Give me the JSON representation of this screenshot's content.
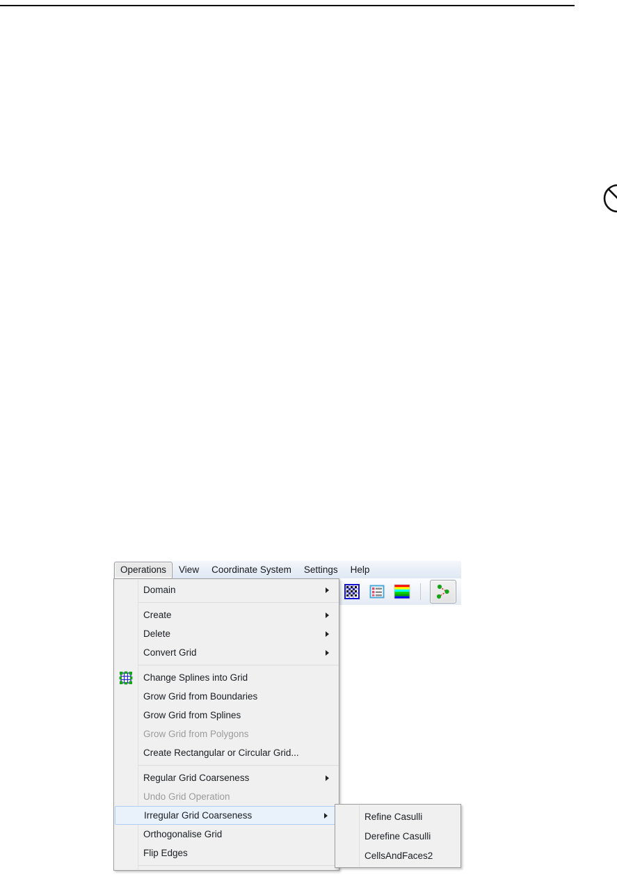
{
  "window": {
    "menubar": [
      {
        "label": "Operations",
        "active": true
      },
      {
        "label": "View",
        "active": false
      },
      {
        "label": "Coordinate System",
        "active": false
      },
      {
        "label": "Settings",
        "active": false
      },
      {
        "label": "Help",
        "active": false
      }
    ],
    "toolbar": {
      "buttons": [
        {
          "icon": "checkerboard-grid-icon",
          "label": "Show Grid",
          "pressed": false
        },
        {
          "icon": "list-properties-icon",
          "label": "Properties List",
          "pressed": false
        },
        {
          "icon": "rainbow-colormap-icon",
          "label": "Colour Map",
          "pressed": false
        },
        {
          "icon": "spline-nodes-icon",
          "label": "Edit Splines",
          "pressed": true
        }
      ]
    }
  },
  "menu": {
    "name": "Operations",
    "items": [
      {
        "label": "Domain",
        "submenu": true,
        "disabled": false,
        "separator_after": true,
        "icon": null
      },
      {
        "label": "Create",
        "submenu": true,
        "disabled": false,
        "separator_after": false,
        "icon": null
      },
      {
        "label": "Delete",
        "submenu": true,
        "disabled": false,
        "separator_after": false,
        "icon": null
      },
      {
        "label": "Convert Grid",
        "submenu": true,
        "disabled": false,
        "separator_after": true,
        "icon": null
      },
      {
        "label": "Change Splines into Grid",
        "submenu": false,
        "disabled": false,
        "separator_after": false,
        "icon": "grid-nodes-icon"
      },
      {
        "label": "Grow Grid from Boundaries",
        "submenu": false,
        "disabled": false,
        "separator_after": false,
        "icon": null
      },
      {
        "label": "Grow Grid from Splines",
        "submenu": false,
        "disabled": false,
        "separator_after": false,
        "icon": null
      },
      {
        "label": "Grow Grid from Polygons",
        "submenu": false,
        "disabled": true,
        "separator_after": false,
        "icon": null
      },
      {
        "label": "Create Rectangular or Circular Grid...",
        "submenu": false,
        "disabled": false,
        "separator_after": true,
        "icon": null
      },
      {
        "label": "Regular Grid Coarseness",
        "submenu": true,
        "disabled": false,
        "separator_after": false,
        "icon": null
      },
      {
        "label": "Undo Grid Operation",
        "submenu": false,
        "disabled": true,
        "separator_after": false,
        "icon": null
      },
      {
        "label": "Irregular Grid Coarseness",
        "submenu": true,
        "disabled": false,
        "highlighted": true,
        "separator_after": false,
        "icon": null
      },
      {
        "label": "Orthogonalise Grid",
        "submenu": false,
        "disabled": false,
        "separator_after": false,
        "icon": null
      },
      {
        "label": "Flip Edges",
        "submenu": false,
        "disabled": false,
        "separator_after": true,
        "icon": null
      }
    ]
  },
  "submenu": {
    "parent": "Irregular Grid Coarseness",
    "items": [
      {
        "label": "Refine Casulli"
      },
      {
        "label": "Derefine Casulli"
      },
      {
        "label": "CellsAndFaces2"
      }
    ]
  },
  "cursor": {
    "icon": "no-entry-icon"
  },
  "colors": {
    "menu_background": "#f0f0f0",
    "menu_border": "#9d9d9d",
    "highlight_fill": "#e9f2fb",
    "highlight_border": "#aecff3",
    "disabled_text": "#9b9b9b",
    "text": "#1a1d21",
    "menubar_gradient_top": "#f4f7fb",
    "menubar_gradient_bottom": "#dfe8f3"
  }
}
